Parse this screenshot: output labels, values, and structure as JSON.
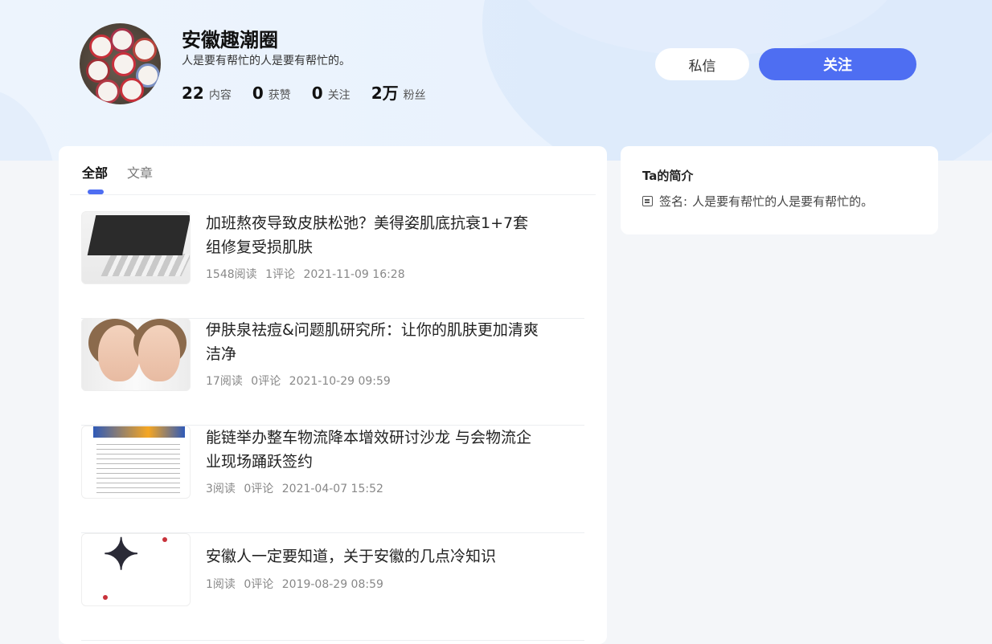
{
  "profile": {
    "name": "安徽趣潮圈",
    "signature": "人是要有帮忙的人是要有帮忙的。",
    "stats": [
      {
        "value": "22",
        "label": "内容"
      },
      {
        "value": "0",
        "label": "获赞"
      },
      {
        "value": "0",
        "label": "关注"
      },
      {
        "value": "2万",
        "label": "粉丝"
      }
    ]
  },
  "actions": {
    "message_label": "私信",
    "follow_label": "关注",
    "follow_color": "#4e6ef2"
  },
  "tabs": [
    {
      "label": "全部",
      "active": true
    },
    {
      "label": "文章",
      "active": false
    }
  ],
  "articles": [
    {
      "title": "加班熬夜导致皮肤松弛？美得姿肌底抗衰1+7套组修复受损肌肤",
      "reads": "1548阅读",
      "comments": "1评论",
      "time": "2021-11-09 16:28"
    },
    {
      "title": "伊肤泉祛痘&问题肌研究所：让你的肌肤更加清爽洁净",
      "reads": "17阅读",
      "comments": "0评论",
      "time": "2021-10-29 09:59"
    },
    {
      "title": "能链举办整车物流降本增效研讨沙龙 与会物流企业现场踊跃签约",
      "reads": "3阅读",
      "comments": "0评论",
      "time": "2021-04-07 15:52"
    },
    {
      "title": "安徽人一定要知道，关于安徽的几点冷知识",
      "reads": "1阅读",
      "comments": "0评论",
      "time": "2019-08-29 08:59"
    }
  ],
  "intro": {
    "title": "Ta的简介",
    "signature_label": "签名:",
    "signature_value": "人是要有帮忙的人是要有帮忙的。"
  }
}
